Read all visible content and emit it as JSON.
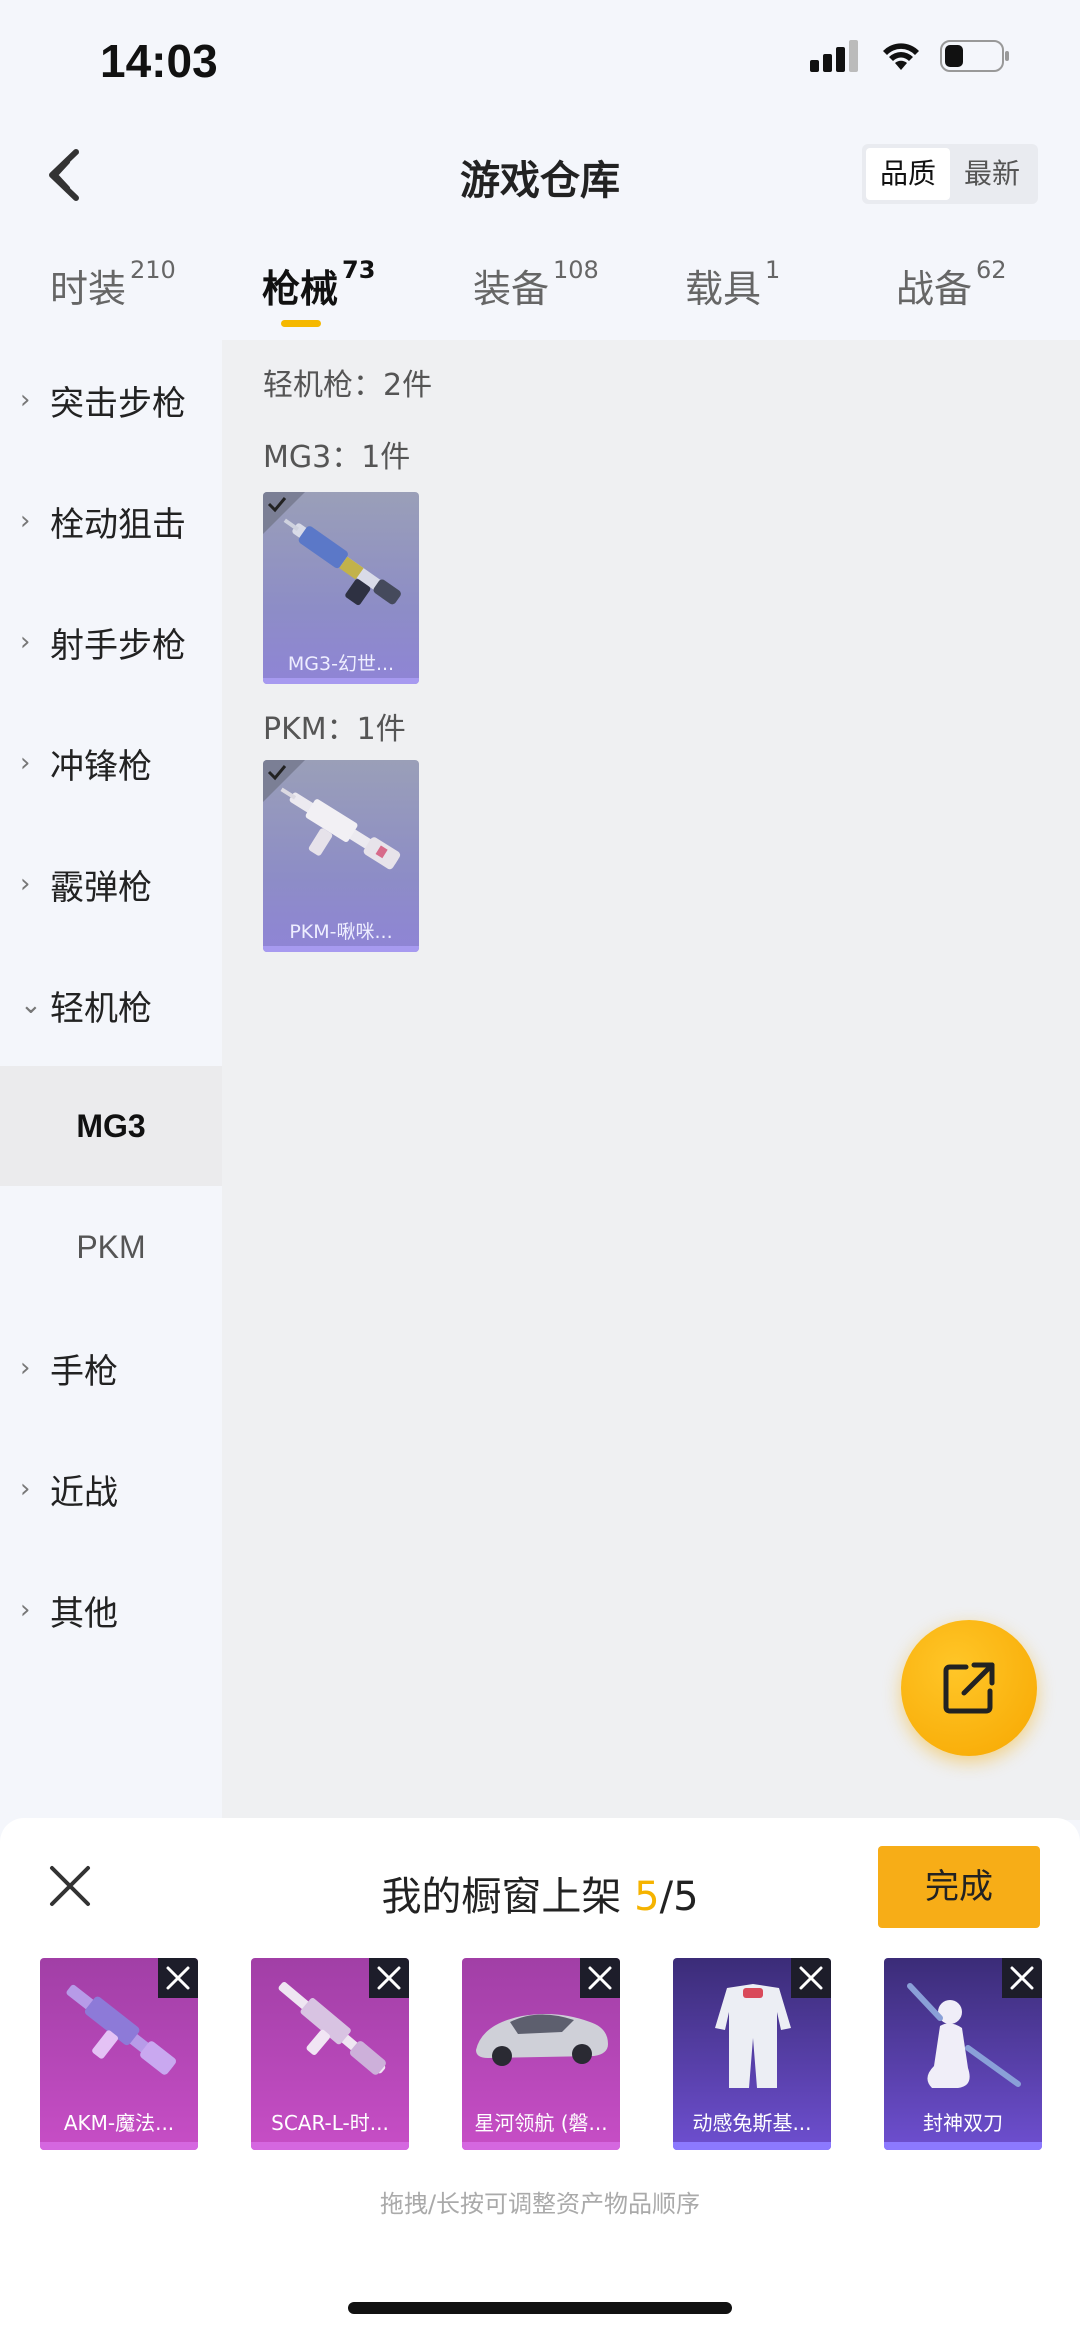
{
  "status": {
    "time": "14:03"
  },
  "header": {
    "title": "游戏仓库",
    "sort_options": [
      "品质",
      "最新"
    ],
    "sort_active": "品质"
  },
  "tabs": [
    {
      "label": "时装",
      "count": "210"
    },
    {
      "label": "枪械",
      "count": "73"
    },
    {
      "label": "装备",
      "count": "108"
    },
    {
      "label": "载具",
      "count": "1"
    },
    {
      "label": "战备",
      "count": "62"
    }
  ],
  "sidebar": {
    "items": [
      {
        "label": "突击步枪"
      },
      {
        "label": "栓动狙击"
      },
      {
        "label": "射手步枪"
      },
      {
        "label": "冲锋枪"
      },
      {
        "label": "霰弹枪"
      },
      {
        "label": "轻机枪"
      },
      {
        "label": "手枪"
      },
      {
        "label": "近战"
      },
      {
        "label": "其他"
      }
    ],
    "sub_items": [
      {
        "label": "MG3"
      },
      {
        "label": "PKM"
      }
    ]
  },
  "main": {
    "category_label": "轻机枪：2件",
    "groups": [
      {
        "label": "MG3：1件",
        "item_name": "MG3-幻世..."
      },
      {
        "label": "PKM：1件",
        "item_name": "PKM-啾咪..."
      }
    ]
  },
  "sheet": {
    "title_prefix": "我的橱窗上架 ",
    "count_current": "5",
    "count_total": "/5",
    "done_label": "完成",
    "items": [
      {
        "name": "AKM-魔法..."
      },
      {
        "name": "SCAR-L-时..."
      },
      {
        "name": "星河领航 (磐..."
      },
      {
        "name": "动感兔斯基..."
      },
      {
        "name": "封神双刀"
      }
    ],
    "hint": "拖拽/长按可调整资产物品顺序"
  },
  "colors": {
    "accent": "#f5b300",
    "done_button": "#f7ad17"
  },
  "icons": [
    "back-icon",
    "share-icon",
    "close-icon",
    "check-icon",
    "remove-icon",
    "chevron-right-icon",
    "chevron-down-icon"
  ]
}
